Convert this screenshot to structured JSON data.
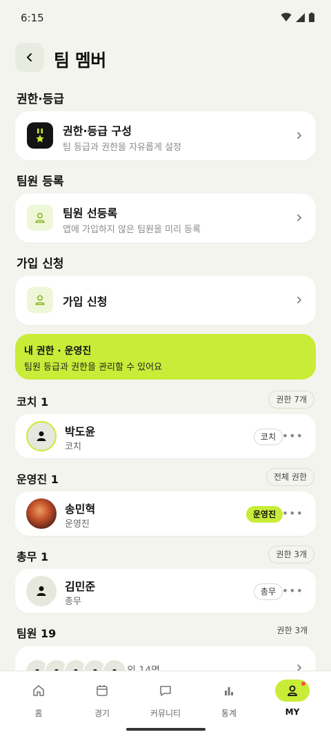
{
  "status": {
    "time": "6:15"
  },
  "header": {
    "title": "팀 멤버"
  },
  "sections": {
    "permissions": {
      "title": "권한·등급",
      "card": {
        "title": "권한·등급 구성",
        "subtitle": "팀 등급과 권한을 자유롭게 설정"
      }
    },
    "registration": {
      "title": "팀원 등록",
      "card": {
        "title": "팀원 선등록",
        "subtitle": "앱에 가입하지 않은 팀원을 미리 등록"
      }
    },
    "join": {
      "title": "가입 신청",
      "card": {
        "title": "가입 신청"
      }
    }
  },
  "banner": {
    "title": "내 권한 · 운영진",
    "subtitle": "팀원 등급과 권한을 관리할 수 있어요"
  },
  "groups": [
    {
      "title": "코치 1",
      "badge": "권한 7개",
      "member": {
        "name": "박도윤",
        "role": "코치",
        "tag": "코치"
      }
    },
    {
      "title": "운영진 1",
      "badge": "전체 권한",
      "member": {
        "name": "송민혁",
        "role": "운영진",
        "tag": "운영진"
      }
    },
    {
      "title": "총무 1",
      "badge": "권한 3개",
      "member": {
        "name": "김민준",
        "role": "총무",
        "tag": "총무"
      }
    },
    {
      "title": "팀원 19",
      "badge": "권한 3개",
      "extra": "외 14명"
    }
  ],
  "more_symbol": "•••",
  "tabbar": [
    {
      "label": "홈",
      "icon": "home-icon"
    },
    {
      "label": "경기",
      "icon": "calendar-icon"
    },
    {
      "label": "커뮤니티",
      "icon": "chat-icon"
    },
    {
      "label": "통계",
      "icon": "bar-chart-icon"
    },
    {
      "label": "MY",
      "icon": "person-icon"
    }
  ],
  "colors": {
    "accent": "#c8ec38",
    "background": "#f4f4ef",
    "notification": "#ff4d3d"
  }
}
